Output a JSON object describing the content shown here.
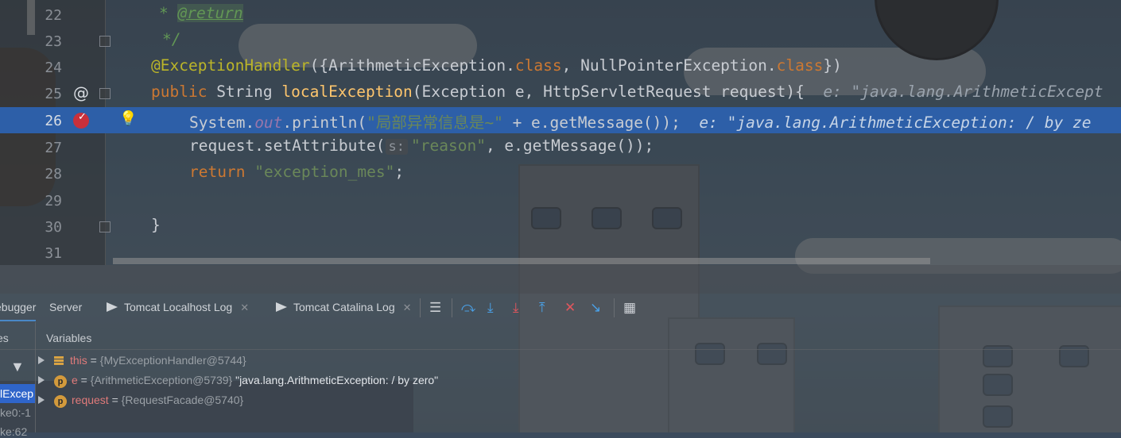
{
  "editor": {
    "lines": [
      {
        "num": "22",
        "doc_star": "* ",
        "doc_tag": "@return"
      },
      {
        "num": "23",
        "doc_end": "*/"
      },
      {
        "num": "24",
        "ann": "@ExceptionHandler",
        "p1": "({",
        "c1": "ArithmeticException",
        "dot1": ".",
        "kw1": "class",
        "comma": ", ",
        "c2": "NullPointerException",
        "dot2": ".",
        "kw2": "class",
        "p2": "})"
      },
      {
        "num": "25",
        "kw": "public",
        "rest1": " String ",
        "fn": "localException",
        "rest2": "(Exception e, HttpServletRequest request){",
        "hint": "e: \"java.lang.ArithmeticExcept"
      },
      {
        "num": "26",
        "pre": "System.",
        "field": "out",
        "mid": ".println(",
        "str": "\"局部异常信息是~\"",
        "post": " + e.getMessage());",
        "hint": "e: \"java.lang.ArithmeticException: / by ze"
      },
      {
        "num": "27",
        "pre": "request.setAttribute(",
        "pname": "s:",
        "str": "\"reason\"",
        "post": ", e.getMessage());"
      },
      {
        "num": "28",
        "kw": "return",
        "str": "\"exception_mes\"",
        "post": ";"
      },
      {
        "num": "29"
      },
      {
        "num": "30",
        "brace": "}"
      },
      {
        "num": "31"
      }
    ]
  },
  "debug": {
    "tabs": {
      "debugger": "ebugger",
      "server": "Server",
      "tomcat_localhost": "Tomcat Localhost Log",
      "tomcat_catalina": "Tomcat Catalina Log"
    },
    "frames_header": "es",
    "variables_header": "Variables",
    "frames": [
      "lExcep",
      "ke0:-1",
      "ke:62"
    ],
    "variables": [
      {
        "name": "this",
        "type": "{MyExceptionHandler@5744}",
        "value": ""
      },
      {
        "name": "e",
        "type": "{ArithmeticException@5739}",
        "value": "\"java.lang.ArithmeticException: / by zero\""
      },
      {
        "name": "request",
        "type": "{RequestFacade@5740}",
        "value": ""
      }
    ],
    "icons": [
      "layout-icon",
      "step-over-icon",
      "step-into-icon",
      "force-step-into-icon",
      "step-out-icon",
      "drop-frame-icon",
      "run-to-cursor-icon",
      "evaluate-icon"
    ]
  }
}
